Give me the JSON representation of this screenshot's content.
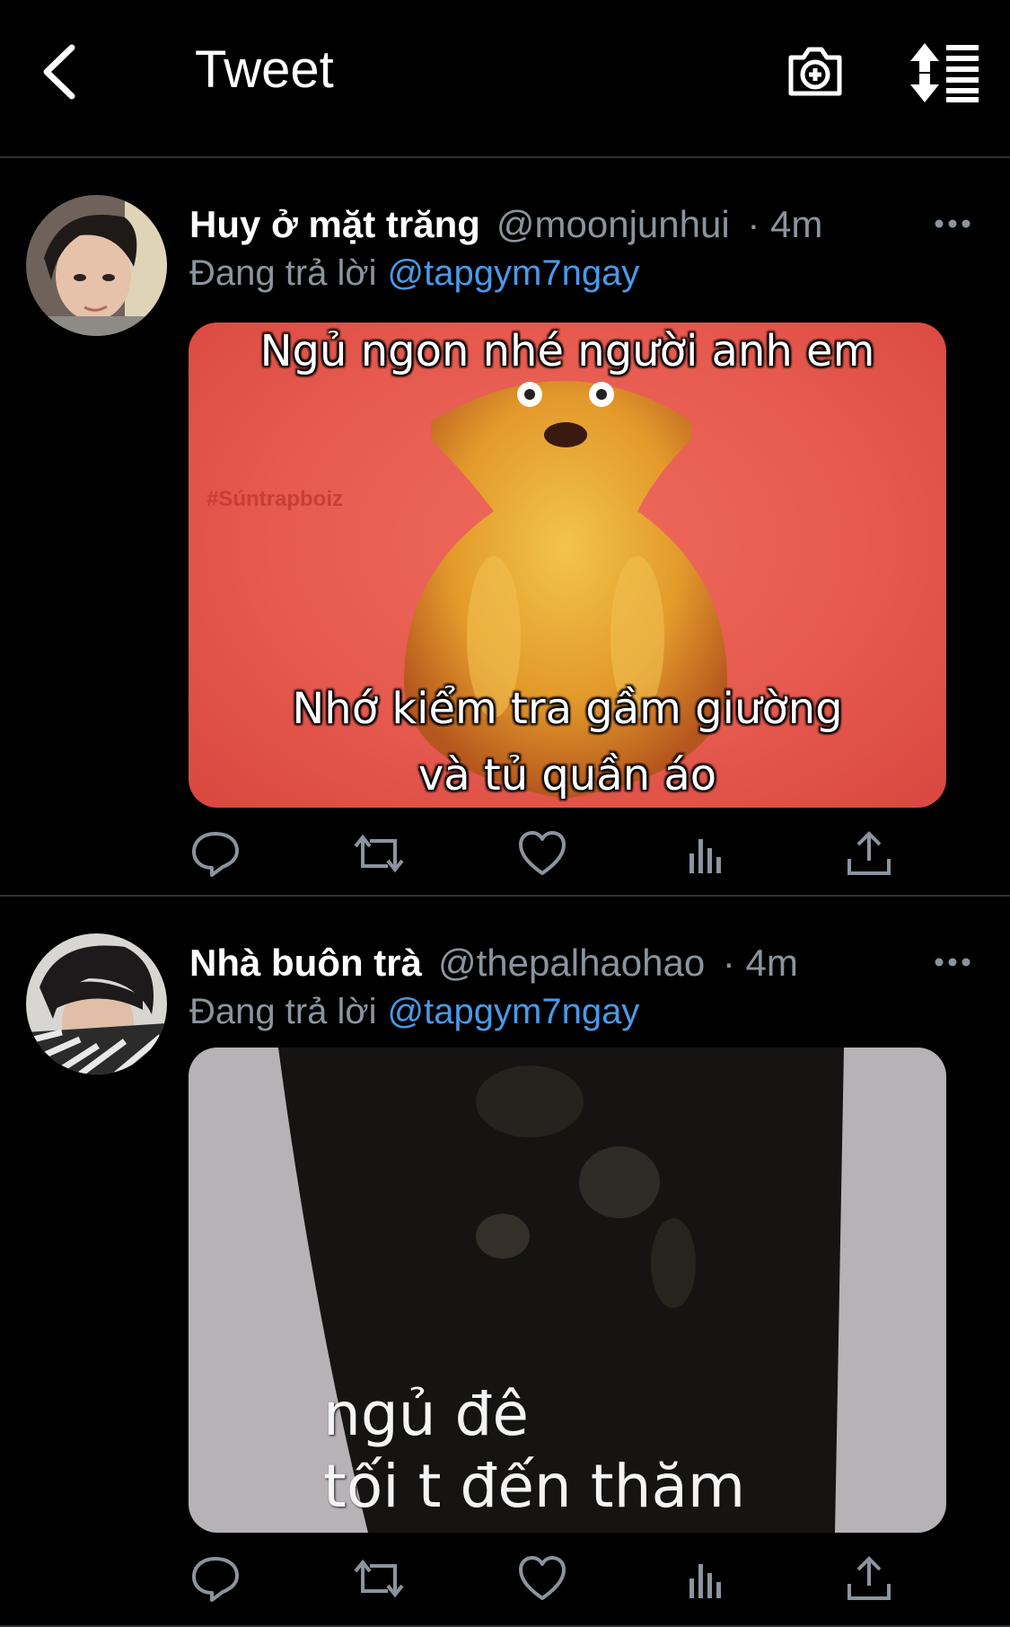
{
  "header": {
    "title": "Tweet",
    "back_icon": "chevron-left-icon",
    "camera_icon": "camera-plus-icon",
    "sort_icon": "sort-icon"
  },
  "colors": {
    "background": "#000000",
    "text_primary": "#ffffff",
    "text_secondary": "#8b949e",
    "link": "#4a99e9",
    "divider": "#2f3336"
  },
  "reply_prefix": "Đang trả lời",
  "tweets": [
    {
      "name": "Huy ở mặt trăng",
      "handle": "@moonjunhui",
      "time": "· 4m",
      "replying_to": "@tapgym7ngay",
      "media": {
        "top_text": "Ngủ ngon nhé người anh em",
        "bottom_text_1": "Nhớ kiểm tra gầm giường",
        "bottom_text_2": "và tủ quần áo",
        "watermark": "#Súntrapboiz"
      }
    },
    {
      "name": "Nhà buôn trà",
      "handle": "@thepalhaohao",
      "time": "· 4m",
      "replying_to": "@tapgym7ngay",
      "media": {
        "line_1": "ngủ đê",
        "line_2": "tối t đến thăm"
      }
    }
  ],
  "actions": [
    "reply-icon",
    "retweet-icon",
    "like-icon",
    "analytics-icon",
    "share-icon"
  ]
}
